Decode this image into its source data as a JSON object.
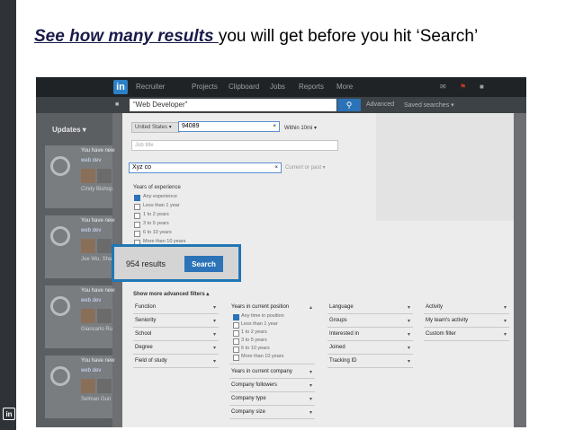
{
  "headline": {
    "emphasis": "See how many results ",
    "rest": "you will get before you hit ‘Search’"
  },
  "brand": {
    "slide_logo": "in",
    "nav_logo": "in"
  },
  "nav": {
    "items": [
      "Recruiter",
      "Projects",
      "Clipboard",
      "Jobs",
      "Reports",
      "More"
    ]
  },
  "subnav": {
    "advanced": "Advanced",
    "saved": "Saved searches ▾"
  },
  "top_search": {
    "value": "“Web Developer”"
  },
  "sidebar": {
    "updates": "Updates ▾"
  },
  "feed": [
    {
      "note": "You have new",
      "name": "web dev",
      "footer": "Cindy Bishop"
    },
    {
      "note": "You have new",
      "name": "web dev",
      "footer": "Joe Wu, Sha"
    },
    {
      "note": "You have new",
      "name": "web dev",
      "footer": "Giancarlo Ru"
    },
    {
      "note": "You have new",
      "name": "web dev",
      "footer": "Selman Gun"
    }
  ],
  "filters": {
    "country": "United States ▾",
    "postal": "94089",
    "within": "Within 10mi ▾",
    "job_title_placeholder": "Job title",
    "company": "Xyz co",
    "current_or_past": "Current or past ▾",
    "years_exp_title": "Years of experience",
    "years_exp": [
      "Any experience",
      "Less than 1 year",
      "1 to 2 years",
      "3 to 5 years",
      "6 to 10 years",
      "More than 10 years"
    ],
    "results": "954 results",
    "search": "Search",
    "show_more": "Show more advanced filters ▴"
  },
  "advanced": {
    "col1": [
      "Function",
      "Seniority",
      "School",
      "Degree",
      "Field of study"
    ],
    "col2_title": "Years in current position",
    "col2_options": [
      "Any time in position",
      "Less than 1 year",
      "1 to 2 years",
      "3 to 5 years",
      "6 to 10 years",
      "More than 10 years"
    ],
    "col2_more": [
      "Years in current company",
      "Company followers",
      "Company type",
      "Company size"
    ],
    "col3": [
      "Language",
      "Groups",
      "Interested in",
      "Joined",
      "Tracking ID"
    ],
    "col4": [
      "Activity",
      "My team's activity",
      "Custom filter"
    ]
  }
}
